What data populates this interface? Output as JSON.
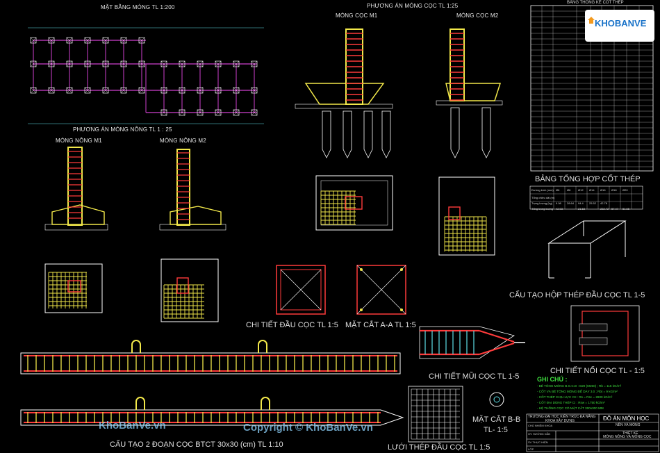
{
  "sheet": {
    "title_site_plan": "MẶT BẰNG MÓNG TL 1:200",
    "title_pile_option": "PHƯƠNG ÁN MÓNG CỌC TL 1:25",
    "title_pile_m1": "MÓNG CỌC M1",
    "title_pile_m2": "MÓNG CỌC M2",
    "title_shallow_option": "PHƯƠNG ÁN MÓNG NÔNG TL 1 : 25",
    "title_shallow_m1": "MÓNG NÔNG M1",
    "title_shallow_m2": "MÓNG NÔNG M2",
    "title_rebar_table": "BẢNG THỐNG KÊ CỐT THÉP",
    "title_rebar_summary": "BẢNG TỔNG HỢP CỐT THÉP",
    "title_steel_box": "CẤU TẠO HỘP THÉP ĐẦU CỌC TL 1-5",
    "title_pile_head": "CHI TIẾT ĐẦU CỌC TL 1:5",
    "title_section_aa": "MẶT CẮT A-A TL 1:5",
    "title_pile_tip": "CHI TIẾT MŨI CỌC TL 1-5",
    "title_pile_joint": "CHI TIẾT NỐI CỌC TL - 1:5",
    "title_notes": "GHI CHÚ :",
    "title_two_piles": "CẤU TẠO 2 ĐOẠN CỌC BTCT 30x30 (cm) TL 1:10",
    "title_section_bb_1": "MẶT CẮT B-B",
    "title_section_bb_2": "TL- 1:5",
    "title_mesh": "LƯỚI THÉP ĐẦU CỌC TL 1:5",
    "notes": [
      "- BÊ TÔNG MÓNG B.G.C.Đ : B20 (M250) ; Rb = 115 kG/m²",
      "- CỐT VÀ BÊ TÔNG MÓNG ĐỂ DÀY 3.0 ; Rbt = 9 kG/m²",
      "- CỐT THÉP CHỊU LỰC CII : Rs = Rsc = 2800 kG/m²",
      "- CỐT ĐAI DÙNG THÉP CI : Rsw = 1750 kG/m²",
      "- HỆ THỐNG CỌC CÓ MẶT CẮT 300x300 MM"
    ],
    "summary_table": {
      "headers": [
        "Đường kính (mm)",
        "Ø6",
        "Ø8",
        "Ø12",
        "Ø14",
        "Ø16",
        "Ø18",
        "Ø20"
      ],
      "rows": [
        [
          "Tổng chiều dài (m)",
          "",
          "",
          "",
          "",
          "",
          "",
          ""
        ],
        [
          "Trọng lượng (kg)",
          "9.08",
          "28.64",
          "94.4",
          "25.52",
          "42.78",
          "",
          ""
        ],
        [
          "Tổng trọng lượng",
          "42.93",
          "",
          "21.68",
          "",
          "232.72",
          "57.47",
          "51.66"
        ]
      ]
    },
    "title_block": {
      "school": "TRƯỜNG ĐẠI HỌC KIẾN TRÚC ĐÀ NẴNG",
      "faculty": "KHOA XÂY DỰNG",
      "project": "ĐỒ ÁN MÔN HỌC",
      "subject": "NỀN VÀ MÓNG",
      "design": "THIẾT KẾ",
      "drawing": "MÓNG NÔNG VÀ MÓNG CỌC",
      "rows": [
        "CHỦ NHIỆM KHOA",
        "GV HƯỚNG DẪN",
        "SV THỰC HIỆN",
        "LỚP"
      ]
    },
    "logo_text": "KHOBANVE",
    "watermark_1": "KhoBanVe.vn",
    "watermark_2": "Copyright © KhoBanVe.vn"
  },
  "colors": {
    "background": "#000000",
    "rebar": "#f2e84a",
    "stirrup": "#ff3b3b",
    "grid": "#d040d0",
    "dimension": "#5fe0e8",
    "concrete": "#ffffff",
    "note": "#3fe03f"
  }
}
